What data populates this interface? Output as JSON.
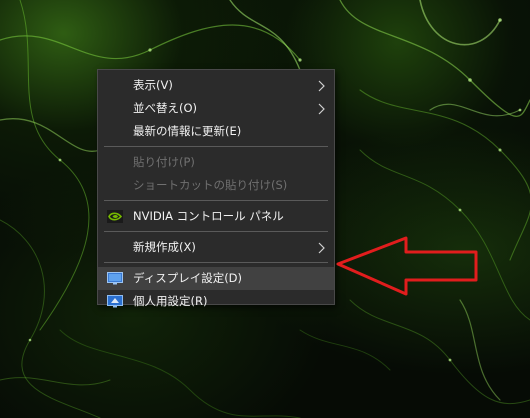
{
  "context_menu": {
    "items": [
      {
        "label": "表示(V)",
        "submenu": true
      },
      {
        "label": "並べ替え(O)",
        "submenu": true
      },
      {
        "label": "最新の情報に更新(E)"
      },
      {
        "label": "貼り付け(P)",
        "disabled": true
      },
      {
        "label": "ショートカットの貼り付け(S)",
        "disabled": true
      },
      {
        "label": "NVIDIA コントロール パネル",
        "icon": "nvidia-icon"
      },
      {
        "label": "新規作成(X)",
        "submenu": true
      },
      {
        "label": "ディスプレイ設定(D)",
        "icon": "display-settings-icon",
        "highlighted": true
      },
      {
        "label": "個人用設定(R)",
        "icon": "personalize-icon"
      }
    ]
  },
  "annotation": {
    "arrow_color": "#e11d1d"
  },
  "colors": {
    "menu_background": "#2b2b2b",
    "menu_text": "#f2f2f2",
    "menu_text_disabled": "#707070",
    "highlight": "#414141",
    "nvidia_green": "#76b900"
  }
}
